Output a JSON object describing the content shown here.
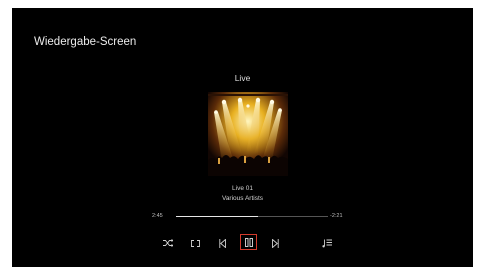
{
  "screen": {
    "title": "Wiedergabe-Screen",
    "source_label": "Live"
  },
  "now_playing": {
    "track": "Live 01",
    "artist": "Various Artists",
    "elapsed": "2:45",
    "remaining": "-2:21",
    "progress_fraction": 0.54
  },
  "controls": [
    {
      "name": "shuffle-icon"
    },
    {
      "name": "repeat-icon"
    },
    {
      "name": "previous-icon"
    },
    {
      "name": "pause-icon",
      "active": true
    },
    {
      "name": "next-icon"
    },
    {
      "name": "playlist-icon"
    }
  ],
  "colors": {
    "background": "#000000",
    "active_outline": "#d43b2c",
    "text": "#dddddd"
  }
}
